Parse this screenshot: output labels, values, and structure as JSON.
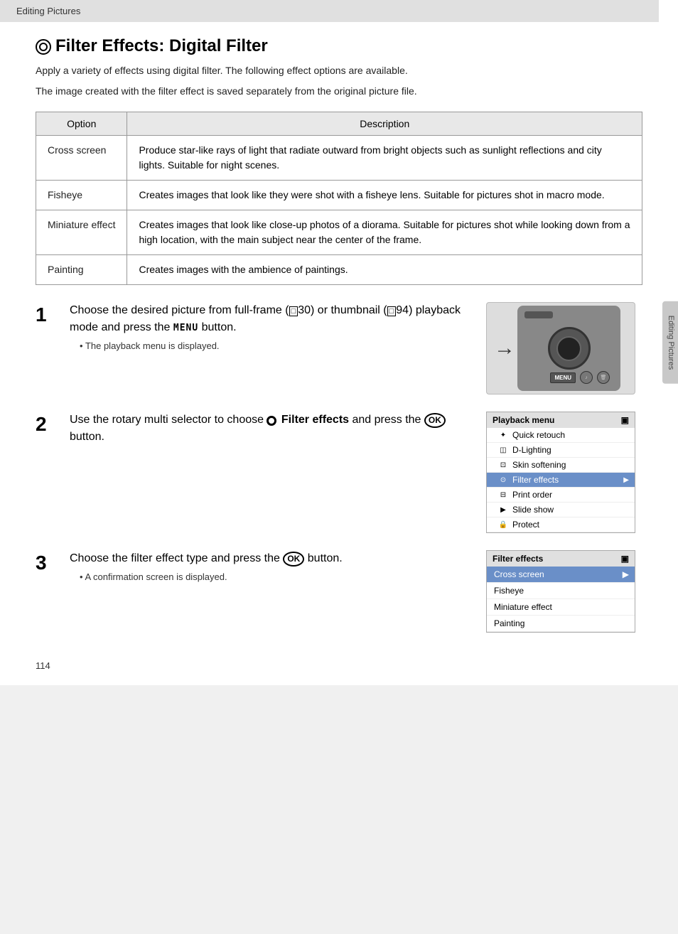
{
  "header": {
    "label": "Editing Pictures"
  },
  "title": {
    "icon": "filter-icon",
    "text": "Filter Effects: Digital Filter"
  },
  "intro": {
    "line1": "Apply a variety of effects using digital filter. The following effect options are available.",
    "line2": "The image created with the filter effect is saved separately from the original picture file."
  },
  "table": {
    "col1": "Option",
    "col2": "Description",
    "rows": [
      {
        "option": "Cross screen",
        "description": "Produce star-like rays of light that radiate outward from bright objects such as sunlight reflections and city lights. Suitable for night scenes."
      },
      {
        "option": "Fisheye",
        "description": "Creates images that look like they were shot with a fisheye lens. Suitable for pictures shot in macro mode."
      },
      {
        "option": "Miniature effect",
        "description": "Creates images that look like close-up photos of a diorama. Suitable for pictures shot while looking down from a high location, with the main subject near the center of the frame."
      },
      {
        "option": "Painting",
        "description": "Creates images with the ambience of paintings."
      }
    ]
  },
  "steps": [
    {
      "number": "1",
      "text_parts": [
        "Choose the desired picture from full-frame (",
        "■30) or thumbnail (",
        "■94) playback mode and press the ",
        "MENU",
        " button."
      ],
      "text_plain": "Choose the desired picture from full-frame (□30) or thumbnail (□94) playback mode and press the MENU button.",
      "sub": "The playback menu is displayed.",
      "has_image": true
    },
    {
      "number": "2",
      "text_plain": "Use the rotary multi selector to choose Filter effects and press the OK button.",
      "sub": null,
      "has_menu": true
    },
    {
      "number": "3",
      "text_plain": "Choose the filter effect type and press the OK button.",
      "sub": "A confirmation screen is displayed.",
      "has_filter": true
    }
  ],
  "playback_menu": {
    "title": "Playback menu",
    "items": [
      {
        "label": "Quick retouch",
        "icon": "✦",
        "active": false
      },
      {
        "label": "D-Lighting",
        "icon": "◫",
        "active": false
      },
      {
        "label": "Skin softening",
        "icon": "⊡",
        "active": false
      },
      {
        "label": "Filter effects",
        "icon": "⊙",
        "active": true,
        "arrow": true
      },
      {
        "label": "Print order",
        "icon": "⊟",
        "active": false
      },
      {
        "label": "Slide show",
        "icon": "▶",
        "active": false
      },
      {
        "label": "Protect",
        "icon": "🔒",
        "active": false
      }
    ]
  },
  "filter_effects_menu": {
    "title": "Filter effects",
    "items": [
      {
        "label": "Cross screen",
        "selected": true,
        "arrow": true
      },
      {
        "label": "Fisheye",
        "selected": false
      },
      {
        "label": "Miniature effect",
        "selected": false
      },
      {
        "label": "Painting",
        "selected": false
      }
    ]
  },
  "page_number": "114",
  "sidebar_label": "Editing Pictures"
}
